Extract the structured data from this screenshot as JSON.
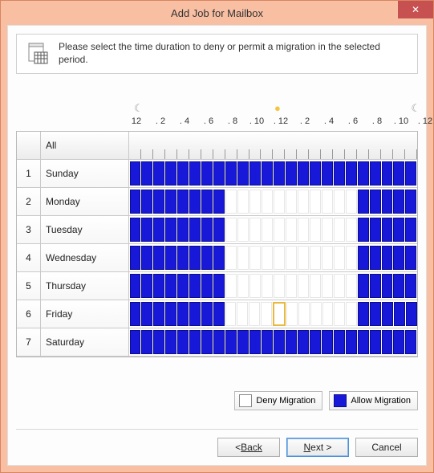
{
  "title": "Add Job for Mailbox",
  "info_text": "Please select the time duration to deny or permit a migration in the selected period.",
  "hour_labels": [
    "12",
    "2",
    "4",
    "6",
    "8",
    "10",
    "12",
    "2",
    "4",
    "6",
    "8",
    "10",
    "12"
  ],
  "all_label": "All",
  "days": [
    {
      "idx": "1",
      "name": "Sunday"
    },
    {
      "idx": "2",
      "name": "Monday"
    },
    {
      "idx": "3",
      "name": "Tuesday"
    },
    {
      "idx": "4",
      "name": "Wednesday"
    },
    {
      "idx": "5",
      "name": "Thursday"
    },
    {
      "idx": "6",
      "name": "Friday"
    },
    {
      "idx": "7",
      "name": "Saturday"
    }
  ],
  "slots_per_day": 24,
  "schedule": {
    "Sunday": "AAAAAAAAAAAAAAAAAAAAAAAA",
    "Monday": "AAAAAAAADDDDDDDDDDDAAAAA",
    "Tuesday": "AAAAAAAADDDDDDDDDDDAAAAA",
    "Wednesday": "AAAAAAAADDDDDDDDDDDAAAAA",
    "Thursday": "AAAAAAAADDDDDDDDDDDAAAAA",
    "Friday": "AAAAAAAADDDDHDDDDDDAAAAA",
    "Saturday": "AAAAAAAAAAAAAAAAAAAAAAAA"
  },
  "legend": {
    "deny": "Deny Migration",
    "allow": "Allow Migration"
  },
  "buttons": {
    "back": "Back",
    "next": "Next >",
    "cancel": "Cancel"
  },
  "colors": {
    "allow": "#1818d8",
    "deny": "#ffffff",
    "accent": "#f8bfa3"
  }
}
